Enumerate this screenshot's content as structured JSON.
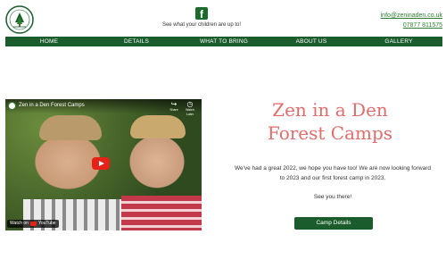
{
  "header": {
    "logo_text": "ZEN IN A DEN",
    "logo_subtext": "FOREST CAMPS",
    "facebook_icon": "facebook-icon",
    "tagline": "See what your children are up to!",
    "email": "info@zeninaden.co.uk",
    "phone": "07877 811575"
  },
  "nav": {
    "items": [
      "HOME",
      "DETAILS",
      "WHAT TO BRING",
      "ABOUT US",
      "GALLERY"
    ]
  },
  "video": {
    "title": "Zen in a Den Forest Camps",
    "share_label": "Share",
    "watch_later_label": "Watch Later",
    "watch_on_label": "Watch on",
    "youtube_label": "YouTube"
  },
  "hero": {
    "title_line1": "Zen in a Den",
    "title_line2": "Forest Camps",
    "text": "We've had a great 2022, we hope you have too! We are now looking forward to 2023 and our first forest camp in 2023.",
    "see_you": "See you there!",
    "button_label": "Camp Details"
  },
  "colors": {
    "brand_green": "#1a5c2b",
    "link_green": "#2e7d32",
    "title_pink": "#e06c6c"
  }
}
